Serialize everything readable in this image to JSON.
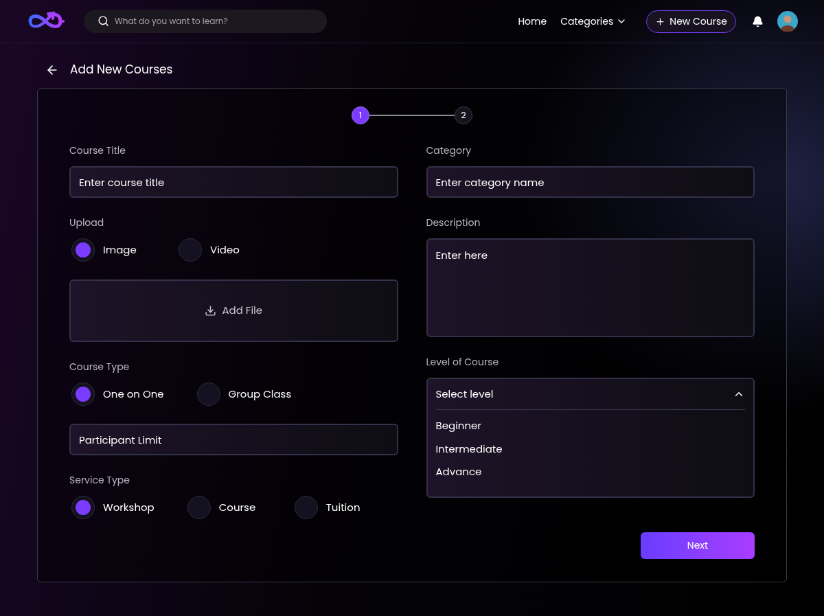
{
  "header": {
    "search": {
      "placeholder": "What do you want to learn?"
    },
    "nav": [
      {
        "label": "Home",
        "kind": "link"
      },
      {
        "label": "Categories",
        "kind": "dropdown"
      }
    ],
    "new_course_button": "New Course"
  },
  "page_title": "Add New Courses",
  "stepper": [
    {
      "label": "1",
      "selected": true
    },
    {
      "label": "2",
      "selected": false
    }
  ],
  "left": [
    {
      "kind": "field",
      "label": "Course Title",
      "placeholder": "Enter course title"
    },
    {
      "kind": "radios",
      "label": "Upload",
      "options": [
        {
          "label": "Image",
          "selected": true
        },
        {
          "label": "Video",
          "selected": false
        }
      ]
    },
    {
      "kind": "upload",
      "label": "Add File"
    },
    {
      "kind": "radios",
      "label": "Course Type",
      "options": [
        {
          "label": "One on One",
          "selected": true
        },
        {
          "label": "Group Class",
          "selected": false
        }
      ]
    },
    {
      "kind": "field",
      "placeholder": "Participant Limit"
    },
    {
      "kind": "radios",
      "label": "Service Type",
      "options": [
        {
          "label": "Workshop",
          "selected": true
        },
        {
          "label": "Course",
          "selected": false
        },
        {
          "label": "Tuition",
          "selected": false
        }
      ]
    }
  ],
  "right": [
    {
      "kind": "field",
      "label": "Category",
      "placeholder": "Enter category name"
    },
    {
      "kind": "textarea",
      "label": "Description",
      "placeholder": "Enter here"
    },
    {
      "kind": "select",
      "label": "Level of Course",
      "placeholder": "Select level",
      "expanded": true,
      "options": [
        {
          "label": "Beginner",
          "selected": false
        },
        {
          "label": "Intermediate",
          "selected": false
        },
        {
          "label": "Advance",
          "selected": false
        }
      ]
    }
  ],
  "next_button": "Next"
}
